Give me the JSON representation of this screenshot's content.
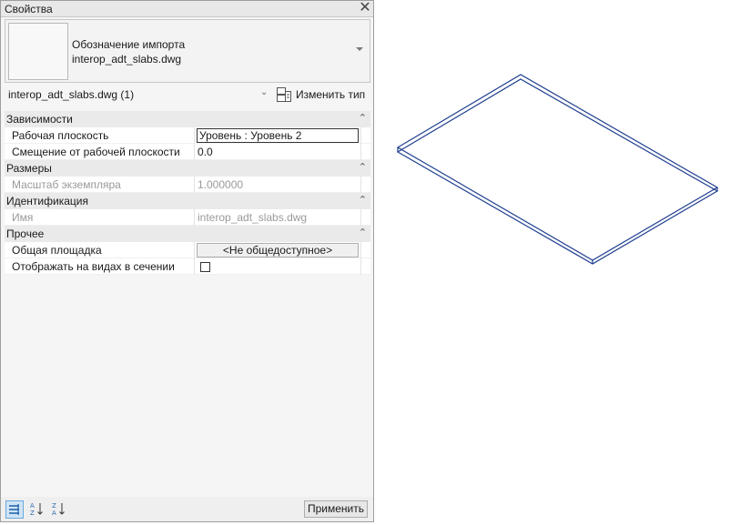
{
  "panel": {
    "title": "Свойства"
  },
  "type_selector": {
    "line1": "Обозначение импорта",
    "line2": "interop_adt_slabs.dwg"
  },
  "instance": {
    "label": "interop_adt_slabs.dwg (1)",
    "edit_type": "Изменить тип"
  },
  "groups": {
    "constraints": "Зависимости",
    "dimensions": "Размеры",
    "identity": "Идентификация",
    "other": "Прочее"
  },
  "rows": {
    "work_plane": {
      "label": "Рабочая плоскость",
      "value": "Уровень : Уровень 2"
    },
    "offset": {
      "label": "Смещение от рабочей плоскости",
      "value": "0.0"
    },
    "scale": {
      "label": "Масштаб экземпляра",
      "value": "1.000000"
    },
    "name": {
      "label": "Имя",
      "value": "interop_adt_slabs.dwg"
    },
    "shared_site": {
      "label": "Общая площадка",
      "value": "<Не общедоступное>"
    },
    "show_in_section": {
      "label": "Отображать на видах в сечении",
      "checked": false
    }
  },
  "footer": {
    "apply": "Применить"
  },
  "colors": {
    "slab_edge": "#1f3f8f",
    "accent": "#2a7fd4"
  }
}
